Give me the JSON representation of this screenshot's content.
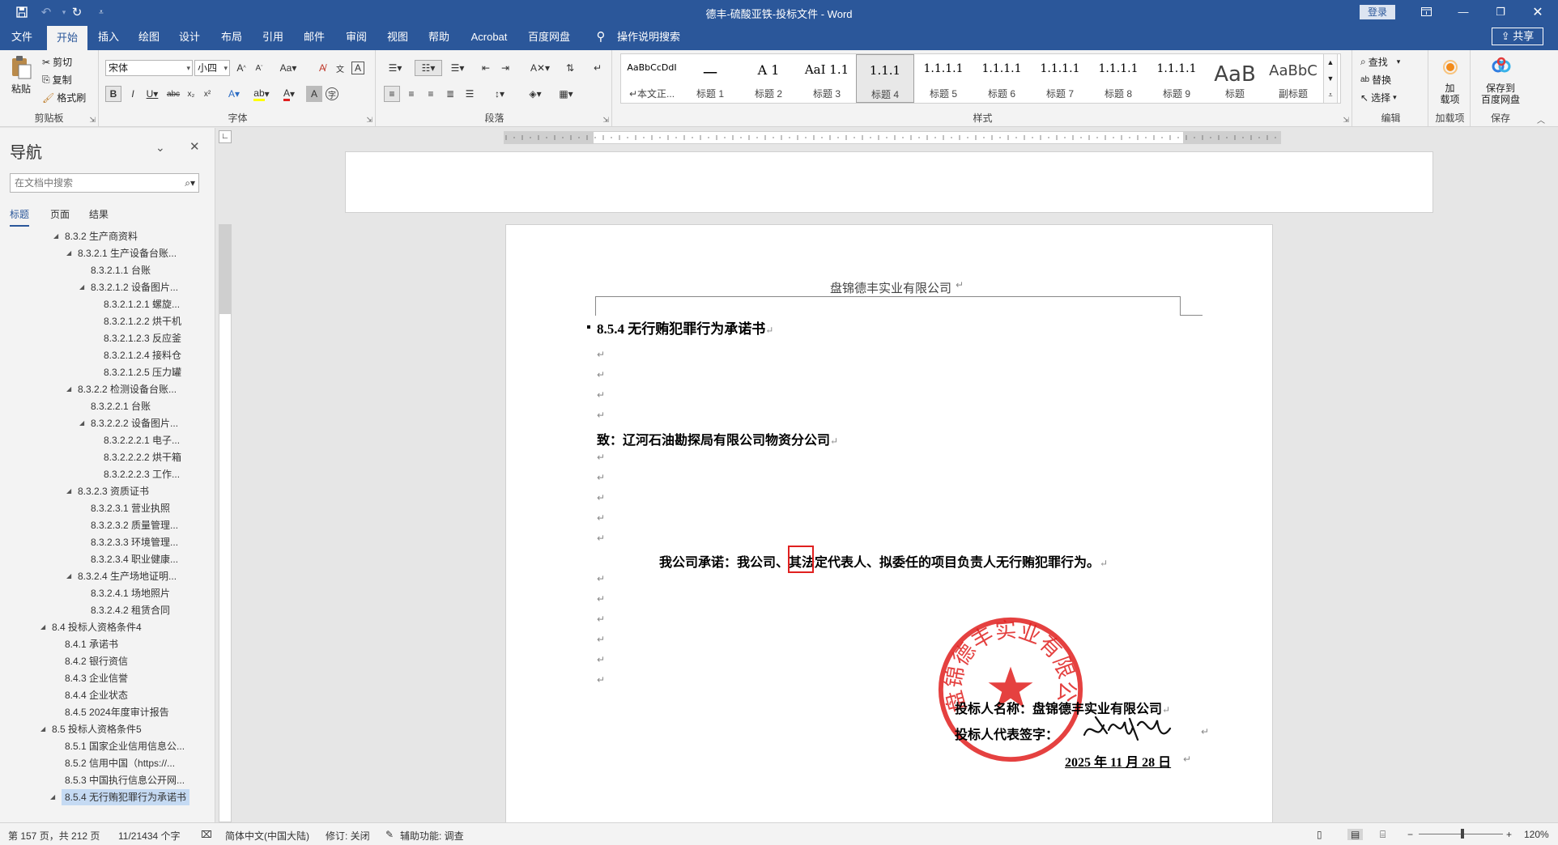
{
  "window": {
    "title": "德丰-硫酸亚铁-投标文件 - Word",
    "login": "登录",
    "share": "共享"
  },
  "menu_tabs": [
    "文件",
    "开始",
    "插入",
    "绘图",
    "设计",
    "布局",
    "引用",
    "邮件",
    "审阅",
    "视图",
    "帮助",
    "Acrobat",
    "百度网盘"
  ],
  "tell_me": "操作说明搜索",
  "ribbon": {
    "clipboard": {
      "paste": "粘贴",
      "cut": "剪切",
      "copy": "复制",
      "format_painter": "格式刷",
      "label": "剪贴板"
    },
    "font": {
      "name": "宋体",
      "size": "小四",
      "label": "字体"
    },
    "paragraph": {
      "label": "段落"
    },
    "styles": {
      "label": "样式",
      "items": [
        {
          "preview": "AaBbCcDdI",
          "name": "↵本文正..."
        },
        {
          "preview": "一",
          "name": "标题 1"
        },
        {
          "preview": "A 1",
          "name": "标题 2"
        },
        {
          "preview": "AaI 1.1",
          "name": "标题 3"
        },
        {
          "preview": "1.1.1",
          "name": "标题 4"
        },
        {
          "preview": "1.1.1.1",
          "name": "标题 5"
        },
        {
          "preview": "1.1.1.1",
          "name": "标题 6"
        },
        {
          "preview": "1.1.1.1",
          "name": "标题 7"
        },
        {
          "preview": "1.1.1.1",
          "name": "标题 8"
        },
        {
          "preview": "1.1.1.1",
          "name": "标题 9"
        },
        {
          "preview": "AaB",
          "name": "标题"
        },
        {
          "preview": "AaBbC",
          "name": "副标题"
        }
      ]
    },
    "editing": {
      "find": "查找",
      "replace": "替换",
      "select": "选择",
      "label": "编辑"
    },
    "addins": {
      "load": "加\n载项",
      "label": "加载项"
    },
    "save": {
      "baidu": "保存到\n百度网盘",
      "label": "保存"
    }
  },
  "nav": {
    "title": "导航",
    "search_placeholder": "在文档中搜索",
    "tabs": [
      "标题",
      "页面",
      "结果"
    ],
    "items": [
      {
        "text": "8.3.2 生产商资料",
        "level": 2,
        "tri": "◢"
      },
      {
        "text": "8.3.2.1 生产设备台账...",
        "level": 3,
        "tri": "◢"
      },
      {
        "text": "8.3.2.1.1 台账",
        "level": 4,
        "tri": ""
      },
      {
        "text": "8.3.2.1.2 设备图片...",
        "level": 4,
        "tri": "◢"
      },
      {
        "text": "8.3.2.1.2.1 螺旋...",
        "level": 5,
        "tri": ""
      },
      {
        "text": "8.3.2.1.2.2 烘干机",
        "level": 5,
        "tri": ""
      },
      {
        "text": "8.3.2.1.2.3 反应釜",
        "level": 5,
        "tri": ""
      },
      {
        "text": "8.3.2.1.2.4 接料仓",
        "level": 5,
        "tri": ""
      },
      {
        "text": "8.3.2.1.2.5 压力罐",
        "level": 5,
        "tri": ""
      },
      {
        "text": "8.3.2.2 检测设备台账...",
        "level": 3,
        "tri": "◢"
      },
      {
        "text": "8.3.2.2.1 台账",
        "level": 4,
        "tri": ""
      },
      {
        "text": "8.3.2.2.2 设备图片...",
        "level": 4,
        "tri": "◢"
      },
      {
        "text": "8.3.2.2.2.1 电子...",
        "level": 5,
        "tri": ""
      },
      {
        "text": "8.3.2.2.2.2 烘干箱",
        "level": 5,
        "tri": ""
      },
      {
        "text": "8.3.2.2.2.3 工作...",
        "level": 5,
        "tri": ""
      },
      {
        "text": "8.3.2.3 资质证书",
        "level": 3,
        "tri": "◢"
      },
      {
        "text": "8.3.2.3.1 营业执照",
        "level": 4,
        "tri": ""
      },
      {
        "text": "8.3.2.3.2 质量管理...",
        "level": 4,
        "tri": ""
      },
      {
        "text": "8.3.2.3.3 环境管理...",
        "level": 4,
        "tri": ""
      },
      {
        "text": "8.3.2.3.4 职业健康...",
        "level": 4,
        "tri": ""
      },
      {
        "text": "8.3.2.4 生产场地证明...",
        "level": 3,
        "tri": "◢"
      },
      {
        "text": "8.3.2.4.1 场地照片",
        "level": 4,
        "tri": ""
      },
      {
        "text": "8.3.2.4.2 租赁合同",
        "level": 4,
        "tri": ""
      },
      {
        "text": "8.4 投标人资格条件4",
        "level": 1,
        "tri": "◢"
      },
      {
        "text": "8.4.1 承诺书",
        "level": 2,
        "tri": ""
      },
      {
        "text": "8.4.2 银行资信",
        "level": 2,
        "tri": ""
      },
      {
        "text": "8.4.3 企业信誉",
        "level": 2,
        "tri": ""
      },
      {
        "text": "8.4.4 企业状态",
        "level": 2,
        "tri": ""
      },
      {
        "text": "8.4.5 2024年度审计报告",
        "level": 2,
        "tri": ""
      },
      {
        "text": "8.5 投标人资格条件5",
        "level": 1,
        "tri": "◢"
      },
      {
        "text": "8.5.1 国家企业信用信息公...",
        "level": 2,
        "tri": ""
      },
      {
        "text": "8.5.2 信用中国（https://...",
        "level": 2,
        "tri": ""
      },
      {
        "text": "8.5.3 中国执行信息公开网...",
        "level": 2,
        "tri": ""
      },
      {
        "text": "8.5.4 无行贿犯罪行为承诺书",
        "level": 2,
        "tri": "◢",
        "selected": true
      }
    ]
  },
  "document": {
    "header": "盘锦德丰实业有限公司",
    "heading": "8.5.4 无行贿犯罪行为承诺书",
    "to_line": "致：辽河石油勘探局有限公司物资分公司",
    "commitment": "我公司承诺：我公司、其法定代表人、拟委任的项目负责人无行贿犯罪行为。",
    "bidder_name": "投标人名称：盘锦德丰实业有限公司",
    "rep_sign": "投标人代表签字：",
    "date": "2025 年 11 月 28 日",
    "return_mark": "↵",
    "seal_text": "盘锦德丰实业有限公司",
    "seal_color": "#e0201f"
  },
  "status": {
    "page": "第 157 页，共 212 页",
    "words": "11/21434 个字",
    "lang": "简体中文(中国大陆)",
    "track": "修订: 关闭",
    "access": "辅助功能: 调查",
    "zoom": "120%"
  }
}
